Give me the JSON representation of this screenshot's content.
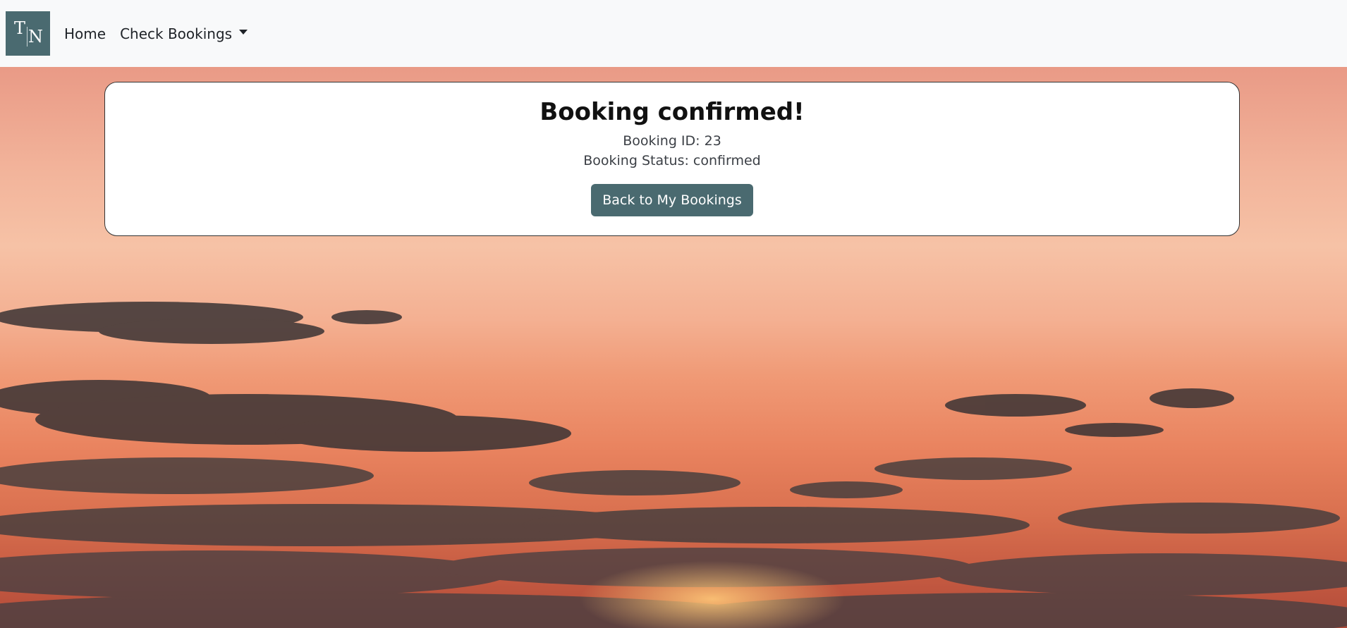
{
  "nav": {
    "logo_letters": [
      "T",
      "N"
    ],
    "home_label": "Home",
    "check_bookings_label": "Check Bookings"
  },
  "confirmation": {
    "title": "Booking confirmed!",
    "booking_id_text": "Booking ID: 23",
    "booking_status_text": "Booking Status: confirmed",
    "back_button_label": "Back to My Bookings"
  },
  "colors": {
    "brand_teal": "#4a6a70",
    "navbar_bg": "#f8f9fa"
  },
  "icons": {
    "dropdown": "caret-down-icon"
  }
}
